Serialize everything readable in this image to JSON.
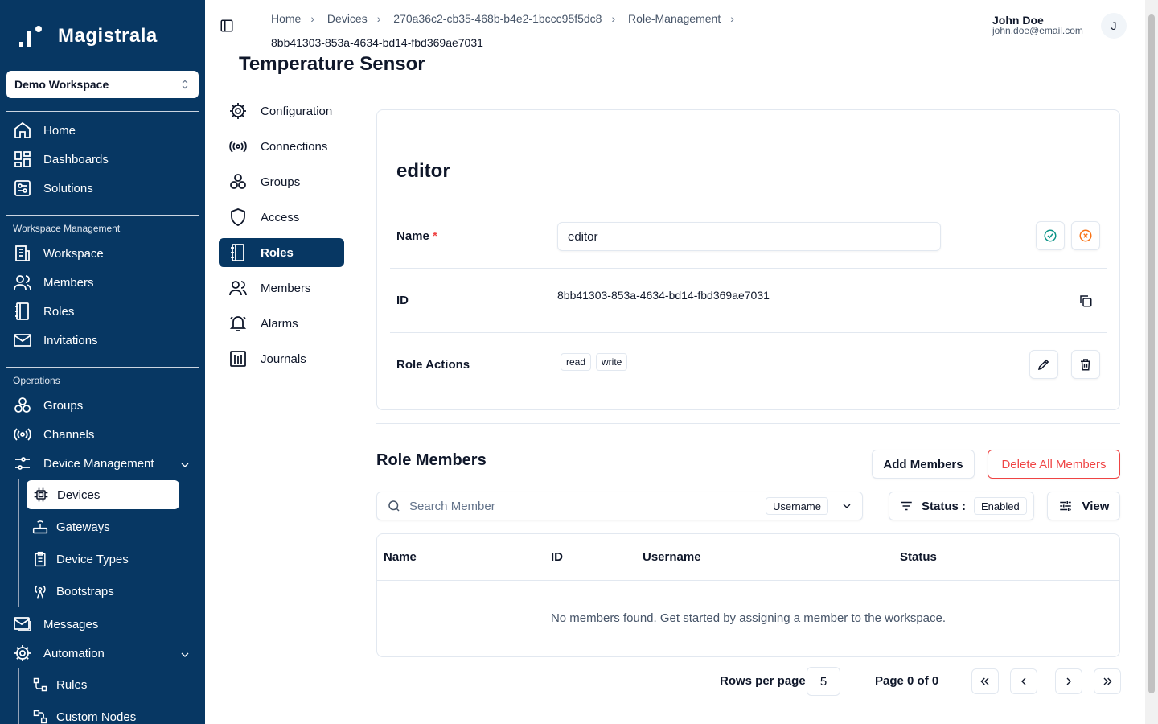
{
  "app": {
    "name": "Magistrala"
  },
  "sidebar": {
    "workspace": "Demo Workspace",
    "main": [
      {
        "label": "Home",
        "icon": "home-icon"
      },
      {
        "label": "Dashboards",
        "icon": "dashboard-icon"
      },
      {
        "label": "Solutions",
        "icon": "solutions-icon"
      }
    ],
    "workspace_section": "Workspace Management",
    "workspace_items": [
      {
        "label": "Workspace",
        "icon": "building-icon"
      },
      {
        "label": "Members",
        "icon": "users-icon"
      },
      {
        "label": "Roles",
        "icon": "roles-icon"
      },
      {
        "label": "Invitations",
        "icon": "mail-icon"
      }
    ],
    "operations_section": "Operations",
    "operations_items": [
      {
        "label": "Groups",
        "icon": "groups-icon"
      },
      {
        "label": "Channels",
        "icon": "broadcast-icon"
      },
      {
        "label": "Device Management",
        "icon": "sliders-icon"
      }
    ],
    "device_sub": [
      {
        "label": "Devices",
        "icon": "chip-icon"
      },
      {
        "label": "Gateways",
        "icon": "router-icon"
      },
      {
        "label": "Device Types",
        "icon": "clipboard-icon"
      },
      {
        "label": "Bootstraps",
        "icon": "antenna-icon"
      }
    ],
    "lower_items": [
      {
        "label": "Messages",
        "icon": "messages-icon"
      },
      {
        "label": "Automation",
        "icon": "gear-icon"
      }
    ],
    "automation_sub": [
      {
        "label": "Rules",
        "icon": "rules-icon"
      },
      {
        "label": "Custom Nodes",
        "icon": "nodes-icon"
      }
    ]
  },
  "breadcrumb": {
    "items": [
      "Home",
      "Devices",
      "270a36c2-cb35-468b-b4e2-1bccc95f5dc8",
      "Role-Management"
    ],
    "current": "8bb41303-853a-4634-bd14-fbd369ae7031"
  },
  "user": {
    "name": "John Doe",
    "email": "john.doe@email.com",
    "initial": "J"
  },
  "page": {
    "title": "Temperature Sensor"
  },
  "subnav": [
    {
      "label": "Configuration",
      "icon": "gear-icon"
    },
    {
      "label": "Connections",
      "icon": "broadcast-icon"
    },
    {
      "label": "Groups",
      "icon": "groups-icon"
    },
    {
      "label": "Access",
      "icon": "shield-icon"
    },
    {
      "label": "Roles",
      "icon": "roles-icon"
    },
    {
      "label": "Members",
      "icon": "users-icon"
    },
    {
      "label": "Alarms",
      "icon": "bell-icon"
    },
    {
      "label": "Journals",
      "icon": "journal-icon"
    }
  ],
  "role": {
    "title": "editor",
    "name_label": "Name",
    "required_mark": "*",
    "name_value": "editor",
    "id_label": "ID",
    "id_value": "8bb41303-853a-4634-bd14-fbd369ae7031",
    "actions_label": "Role Actions",
    "actions": [
      "read",
      "write"
    ]
  },
  "members": {
    "title": "Role Members",
    "add_label": "Add Members",
    "delete_all_label": "Delete All Members",
    "search_placeholder": "Search Member",
    "search_field": "Username",
    "status_label": "Status :",
    "status_value": "Enabled",
    "view_label": "View",
    "columns": [
      "Name",
      "ID",
      "Username",
      "Status"
    ],
    "empty": "No members found. Get started by assigning a member to the workspace."
  },
  "pagination": {
    "rows_label": "Rows per page",
    "rows_value": "5",
    "page_label": "Page 0 of 0"
  },
  "colors": {
    "sidebar": "#073763",
    "danger": "#ef4444",
    "success": "#0d9488",
    "cancel": "#f97316"
  }
}
